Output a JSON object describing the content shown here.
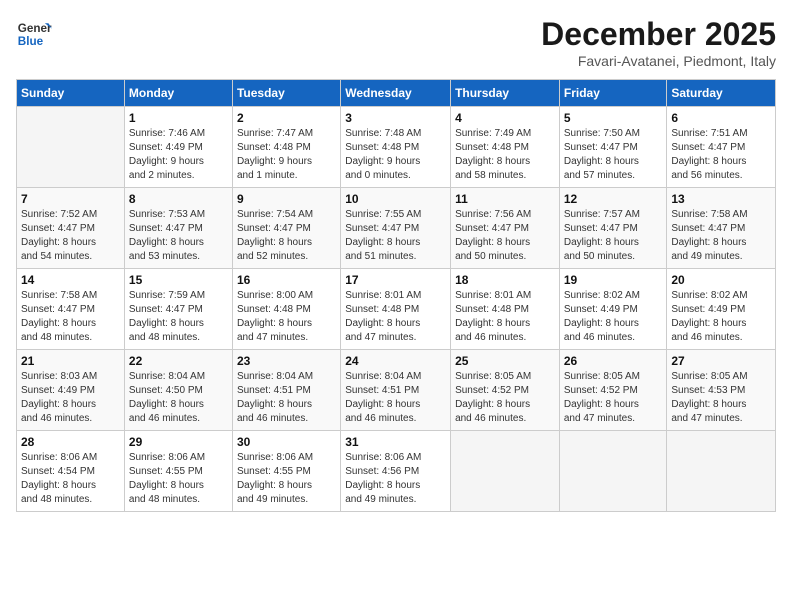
{
  "logo": {
    "general": "General",
    "blue": "Blue"
  },
  "title": "December 2025",
  "location": "Favari-Avatanei, Piedmont, Italy",
  "weekdays": [
    "Sunday",
    "Monday",
    "Tuesday",
    "Wednesday",
    "Thursday",
    "Friday",
    "Saturday"
  ],
  "weeks": [
    [
      {
        "day": "",
        "info": ""
      },
      {
        "day": "1",
        "info": "Sunrise: 7:46 AM\nSunset: 4:49 PM\nDaylight: 9 hours\nand 2 minutes."
      },
      {
        "day": "2",
        "info": "Sunrise: 7:47 AM\nSunset: 4:48 PM\nDaylight: 9 hours\nand 1 minute."
      },
      {
        "day": "3",
        "info": "Sunrise: 7:48 AM\nSunset: 4:48 PM\nDaylight: 9 hours\nand 0 minutes."
      },
      {
        "day": "4",
        "info": "Sunrise: 7:49 AM\nSunset: 4:48 PM\nDaylight: 8 hours\nand 58 minutes."
      },
      {
        "day": "5",
        "info": "Sunrise: 7:50 AM\nSunset: 4:47 PM\nDaylight: 8 hours\nand 57 minutes."
      },
      {
        "day": "6",
        "info": "Sunrise: 7:51 AM\nSunset: 4:47 PM\nDaylight: 8 hours\nand 56 minutes."
      }
    ],
    [
      {
        "day": "7",
        "info": "Sunrise: 7:52 AM\nSunset: 4:47 PM\nDaylight: 8 hours\nand 54 minutes."
      },
      {
        "day": "8",
        "info": "Sunrise: 7:53 AM\nSunset: 4:47 PM\nDaylight: 8 hours\nand 53 minutes."
      },
      {
        "day": "9",
        "info": "Sunrise: 7:54 AM\nSunset: 4:47 PM\nDaylight: 8 hours\nand 52 minutes."
      },
      {
        "day": "10",
        "info": "Sunrise: 7:55 AM\nSunset: 4:47 PM\nDaylight: 8 hours\nand 51 minutes."
      },
      {
        "day": "11",
        "info": "Sunrise: 7:56 AM\nSunset: 4:47 PM\nDaylight: 8 hours\nand 50 minutes."
      },
      {
        "day": "12",
        "info": "Sunrise: 7:57 AM\nSunset: 4:47 PM\nDaylight: 8 hours\nand 50 minutes."
      },
      {
        "day": "13",
        "info": "Sunrise: 7:58 AM\nSunset: 4:47 PM\nDaylight: 8 hours\nand 49 minutes."
      }
    ],
    [
      {
        "day": "14",
        "info": "Sunrise: 7:58 AM\nSunset: 4:47 PM\nDaylight: 8 hours\nand 48 minutes."
      },
      {
        "day": "15",
        "info": "Sunrise: 7:59 AM\nSunset: 4:47 PM\nDaylight: 8 hours\nand 48 minutes."
      },
      {
        "day": "16",
        "info": "Sunrise: 8:00 AM\nSunset: 4:48 PM\nDaylight: 8 hours\nand 47 minutes."
      },
      {
        "day": "17",
        "info": "Sunrise: 8:01 AM\nSunset: 4:48 PM\nDaylight: 8 hours\nand 47 minutes."
      },
      {
        "day": "18",
        "info": "Sunrise: 8:01 AM\nSunset: 4:48 PM\nDaylight: 8 hours\nand 46 minutes."
      },
      {
        "day": "19",
        "info": "Sunrise: 8:02 AM\nSunset: 4:49 PM\nDaylight: 8 hours\nand 46 minutes."
      },
      {
        "day": "20",
        "info": "Sunrise: 8:02 AM\nSunset: 4:49 PM\nDaylight: 8 hours\nand 46 minutes."
      }
    ],
    [
      {
        "day": "21",
        "info": "Sunrise: 8:03 AM\nSunset: 4:49 PM\nDaylight: 8 hours\nand 46 minutes."
      },
      {
        "day": "22",
        "info": "Sunrise: 8:04 AM\nSunset: 4:50 PM\nDaylight: 8 hours\nand 46 minutes."
      },
      {
        "day": "23",
        "info": "Sunrise: 8:04 AM\nSunset: 4:51 PM\nDaylight: 8 hours\nand 46 minutes."
      },
      {
        "day": "24",
        "info": "Sunrise: 8:04 AM\nSunset: 4:51 PM\nDaylight: 8 hours\nand 46 minutes."
      },
      {
        "day": "25",
        "info": "Sunrise: 8:05 AM\nSunset: 4:52 PM\nDaylight: 8 hours\nand 46 minutes."
      },
      {
        "day": "26",
        "info": "Sunrise: 8:05 AM\nSunset: 4:52 PM\nDaylight: 8 hours\nand 47 minutes."
      },
      {
        "day": "27",
        "info": "Sunrise: 8:05 AM\nSunset: 4:53 PM\nDaylight: 8 hours\nand 47 minutes."
      }
    ],
    [
      {
        "day": "28",
        "info": "Sunrise: 8:06 AM\nSunset: 4:54 PM\nDaylight: 8 hours\nand 48 minutes."
      },
      {
        "day": "29",
        "info": "Sunrise: 8:06 AM\nSunset: 4:55 PM\nDaylight: 8 hours\nand 48 minutes."
      },
      {
        "day": "30",
        "info": "Sunrise: 8:06 AM\nSunset: 4:55 PM\nDaylight: 8 hours\nand 49 minutes."
      },
      {
        "day": "31",
        "info": "Sunrise: 8:06 AM\nSunset: 4:56 PM\nDaylight: 8 hours\nand 49 minutes."
      },
      {
        "day": "",
        "info": ""
      },
      {
        "day": "",
        "info": ""
      },
      {
        "day": "",
        "info": ""
      }
    ]
  ]
}
